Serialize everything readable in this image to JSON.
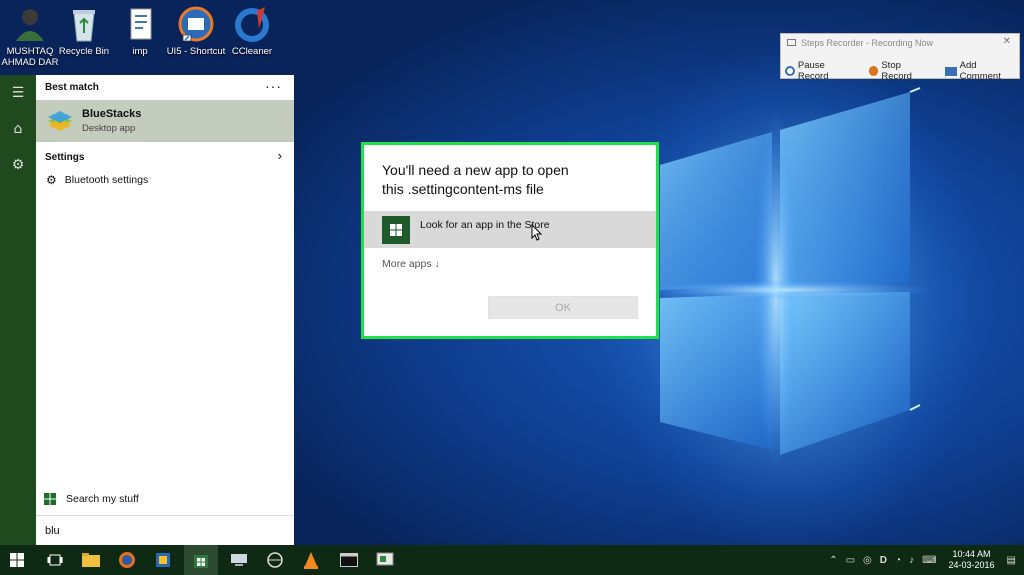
{
  "desktop": {
    "icons": [
      {
        "label": "MUSHTAQ AHMAD DAR",
        "icon": "user-folder-icon"
      },
      {
        "label": "Recycle Bin",
        "icon": "recycle-bin-icon"
      },
      {
        "label": "imp",
        "icon": "document-icon"
      },
      {
        "label": "UI5 - Shortcut",
        "icon": "shortcut-icon"
      },
      {
        "label": "CCleaner",
        "icon": "ccleaner-icon"
      }
    ]
  },
  "steps_recorder": {
    "title": "Steps Recorder - Recording Now",
    "pause": "Pause Record",
    "stop": "Stop Record",
    "add_comment": "Add Comment"
  },
  "start_menu": {
    "best_match_label": "Best match",
    "more_label": "···",
    "best_app_name": "BlueStacks",
    "best_app_sub": "Desktop app",
    "settings_label": "Settings",
    "settings_item": "Bluetooth settings",
    "search_my_stuff": "Search my stuff",
    "search_query": "blu"
  },
  "dialog": {
    "title_line1": "You'll need a new app to open",
    "title_line2": "this .settingcontent-ms file",
    "store_option": "Look for an app in the Store",
    "more_apps": "More apps ↓",
    "ok": "OK"
  },
  "taskbar": {
    "time": "10:44 AM",
    "date": "24-03-2016"
  },
  "colors": {
    "accent_green": "#22e04a",
    "start_green": "#1e4a1e",
    "taskbar": "#0e2a14"
  }
}
